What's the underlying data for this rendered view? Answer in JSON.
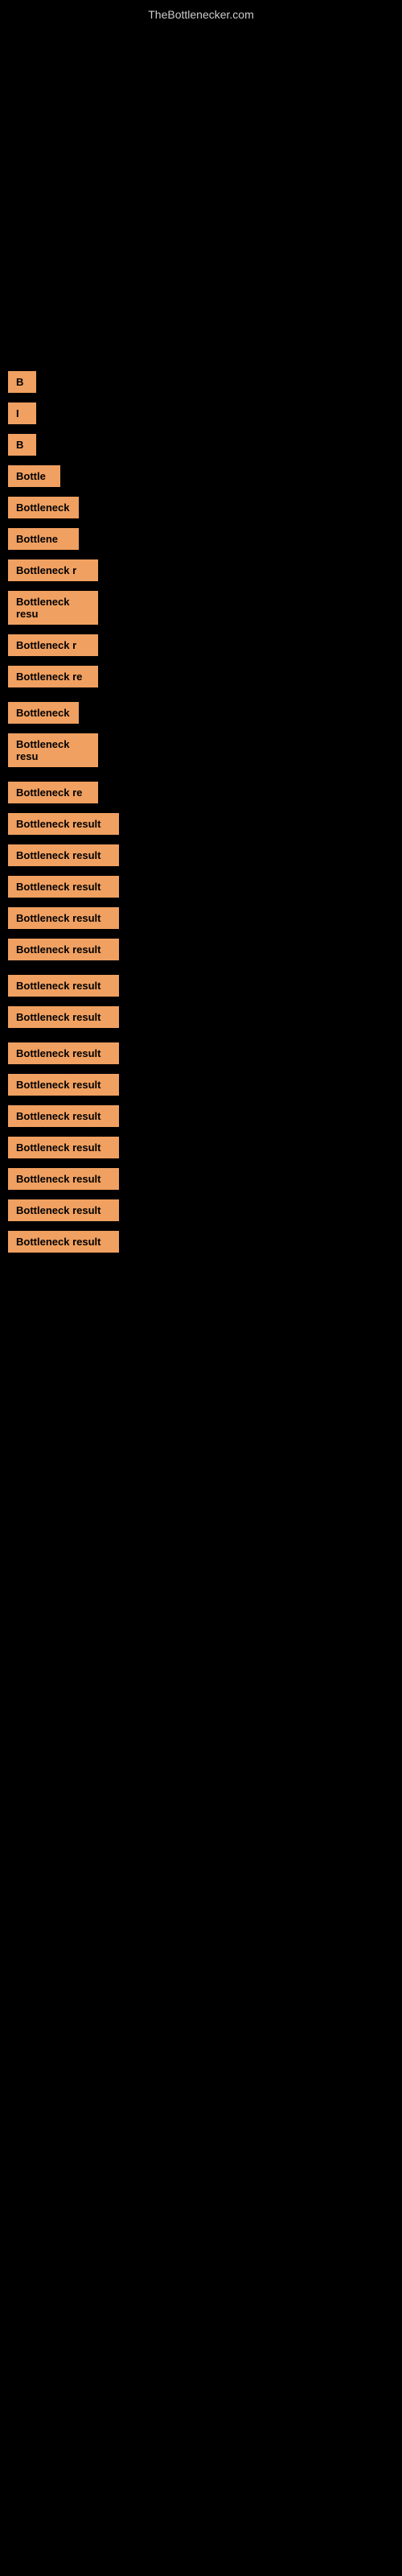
{
  "site": {
    "title": "TheBottlenecker.com"
  },
  "results": [
    {
      "label": "B",
      "size": "xs",
      "marginBottom": 12
    },
    {
      "label": "I",
      "size": "xs",
      "marginBottom": 12
    },
    {
      "label": "B",
      "size": "xs",
      "marginBottom": 12
    },
    {
      "label": "Bottle",
      "size": "sm",
      "marginBottom": 12
    },
    {
      "label": "Bottleneck",
      "size": "md",
      "marginBottom": 12
    },
    {
      "label": "Bottlene",
      "size": "md",
      "marginBottom": 12
    },
    {
      "label": "Bottleneck r",
      "size": "lg",
      "marginBottom": 12
    },
    {
      "label": "Bottleneck resu",
      "size": "lg",
      "marginBottom": 12
    },
    {
      "label": "Bottleneck r",
      "size": "lg",
      "marginBottom": 12
    },
    {
      "label": "Bottleneck re",
      "size": "lg",
      "marginBottom": 12
    },
    {
      "label": "Bottleneck",
      "size": "md",
      "marginBottom": 12
    },
    {
      "label": "Bottleneck resu",
      "size": "lg",
      "marginBottom": 12
    },
    {
      "label": "Bottleneck re",
      "size": "lg",
      "marginBottom": 12
    },
    {
      "label": "Bottleneck result",
      "size": "xl",
      "marginBottom": 12
    },
    {
      "label": "Bottleneck result",
      "size": "xl",
      "marginBottom": 12
    },
    {
      "label": "Bottleneck result",
      "size": "xl",
      "marginBottom": 12
    },
    {
      "label": "Bottleneck result",
      "size": "xl",
      "marginBottom": 12
    },
    {
      "label": "Bottleneck result",
      "size": "xl",
      "marginBottom": 12
    },
    {
      "label": "Bottleneck result",
      "size": "xl",
      "marginBottom": 12
    },
    {
      "label": "Bottleneck result",
      "size": "xl",
      "marginBottom": 12
    },
    {
      "label": "Bottleneck result",
      "size": "xl",
      "marginBottom": 12
    },
    {
      "label": "Bottleneck result",
      "size": "xl",
      "marginBottom": 12
    },
    {
      "label": "Bottleneck result",
      "size": "xl",
      "marginBottom": 12
    },
    {
      "label": "Bottleneck result",
      "size": "xl",
      "marginBottom": 12
    },
    {
      "label": "Bottleneck result",
      "size": "xl",
      "marginBottom": 12
    },
    {
      "label": "Bottleneck result",
      "size": "xl",
      "marginBottom": 12
    },
    {
      "label": "Bottleneck result",
      "size": "xl",
      "marginBottom": 12
    }
  ]
}
